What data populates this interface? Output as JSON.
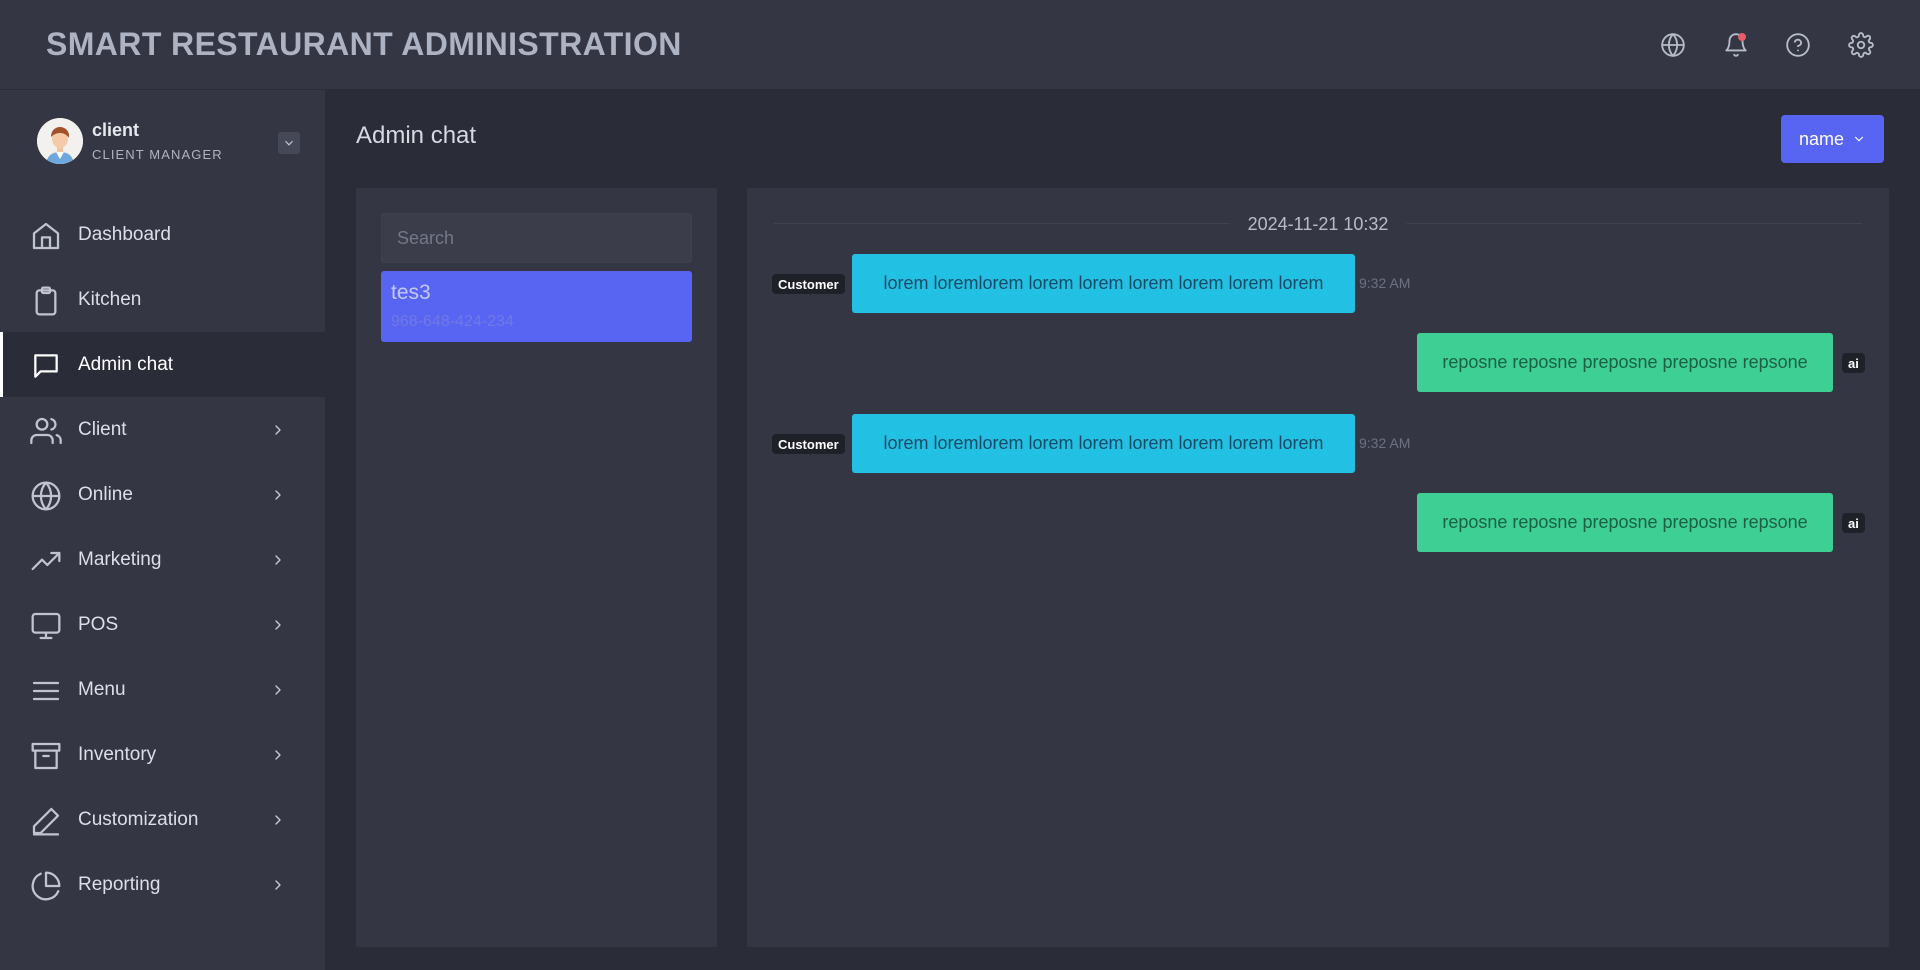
{
  "header": {
    "title": "SMART RESTAURANT ADMINISTRATION",
    "icons": [
      "globe-icon",
      "bell-icon",
      "help-icon",
      "settings-icon"
    ],
    "notification_dot_color": "#e35d6a"
  },
  "sidebar": {
    "profile": {
      "name": "client",
      "role": "CLIENT MANAGER"
    },
    "items": [
      {
        "label": "Dashboard",
        "icon": "home-icon",
        "has_submenu": false,
        "active": false
      },
      {
        "label": "Kitchen",
        "icon": "clipboard-icon",
        "has_submenu": false,
        "active": false
      },
      {
        "label": "Admin chat",
        "icon": "chat-icon",
        "has_submenu": false,
        "active": true
      },
      {
        "label": "Client",
        "icon": "users-icon",
        "has_submenu": true,
        "active": false
      },
      {
        "label": "Online",
        "icon": "globe-icon",
        "has_submenu": true,
        "active": false
      },
      {
        "label": "Marketing",
        "icon": "trending-up-icon",
        "has_submenu": true,
        "active": false
      },
      {
        "label": "POS",
        "icon": "monitor-icon",
        "has_submenu": true,
        "active": false
      },
      {
        "label": "Menu",
        "icon": "menu-lines-icon",
        "has_submenu": true,
        "active": false
      },
      {
        "label": "Inventory",
        "icon": "archive-icon",
        "has_submenu": true,
        "active": false
      },
      {
        "label": "Customization",
        "icon": "pen-icon",
        "has_submenu": true,
        "active": false
      },
      {
        "label": "Reporting",
        "icon": "pie-chart-icon",
        "has_submenu": true,
        "active": false
      }
    ]
  },
  "main": {
    "page_title": "Admin chat",
    "sort_button_label": "name",
    "search": {
      "placeholder": "Search",
      "value": ""
    },
    "contacts": [
      {
        "name": "tes3",
        "phone": "968-648-424-234"
      }
    ],
    "chat": {
      "date_divider": "2024-11-21 10:32",
      "messages": [
        {
          "sender": "Customer",
          "text": "lorem loremlorem lorem lorem lorem lorem lorem lorem",
          "time": "9:32 AM"
        },
        {
          "sender": "ai",
          "text": "reposne reposne preposne preposne repsone",
          "time": ""
        },
        {
          "sender": "Customer",
          "text": "lorem loremlorem lorem lorem lorem lorem lorem lorem",
          "time": "9:32 AM"
        },
        {
          "sender": "ai",
          "text": "reposne reposne preposne preposne repsone",
          "time": ""
        }
      ]
    }
  },
  "colors": {
    "accent": "#5865f2",
    "customer_bubble": "#22c0e2",
    "ai_bubble": "#3ecf94",
    "panel_bg": "#343743",
    "page_bg": "#2a2d37"
  }
}
